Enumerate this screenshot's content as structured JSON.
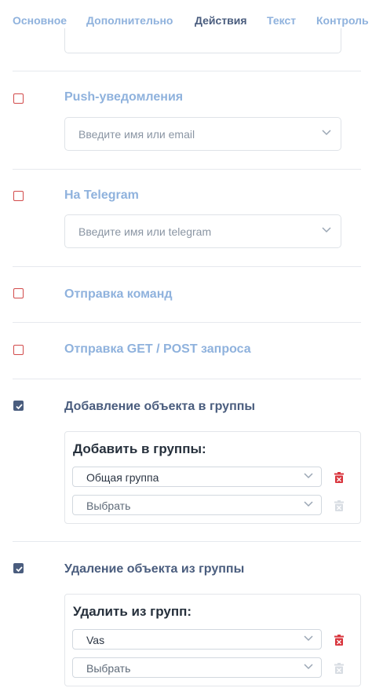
{
  "tabs": [
    "Основное",
    "Дополнительно",
    "Действия",
    "Текст",
    "Контроль"
  ],
  "active_tab": "Действия",
  "sections": {
    "push": {
      "title": "Push-уведомления",
      "checked": false,
      "placeholder": "Введите имя или email"
    },
    "telegram": {
      "title": "На Telegram",
      "checked": false,
      "placeholder": "Введите имя или telegram"
    },
    "commands": {
      "title": "Отправка команд",
      "checked": false
    },
    "http": {
      "title": "Отправка GET / POST запроса",
      "checked": false
    },
    "add_group": {
      "title": "Добавление объекта в группы",
      "checked": true,
      "panel_title": "Добавить в группы:",
      "rows": [
        "Общая группа",
        "Выбрать"
      ]
    },
    "remove_group": {
      "title": "Удаление объекта из группы",
      "checked": true,
      "panel_title": "Удалить из групп:",
      "rows": [
        "Vas",
        "Выбрать"
      ]
    }
  },
  "colors": {
    "accent": "#4a5d7e",
    "link_light": "#8fb2dd",
    "danger": "#d9363e",
    "checkbox_unchecked_border": "#d24a4a"
  },
  "icons": [
    "chevron-down-icon",
    "checkmark-icon",
    "trash-icon"
  ]
}
